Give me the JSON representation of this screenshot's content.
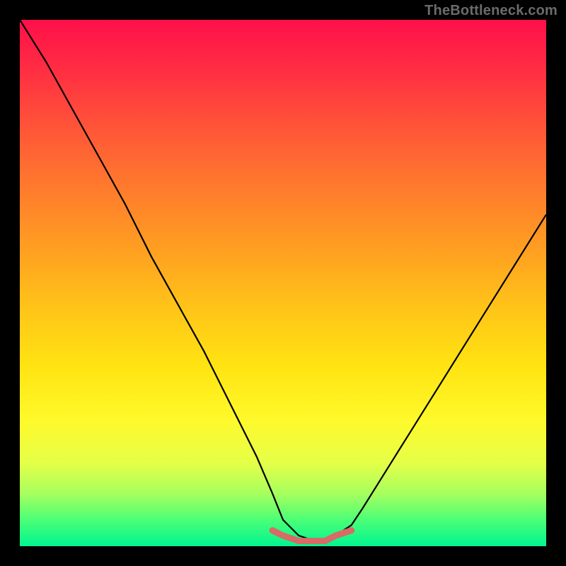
{
  "watermark": "TheBottleneck.com",
  "colors": {
    "frame": "#000000",
    "curve": "#000000",
    "bottom_marker": "#d96a66",
    "gradient_top": "#ff0f4a",
    "gradient_mid": "#ffe412",
    "gradient_bottom": "#00f58f"
  },
  "chart_data": {
    "type": "line",
    "title": "",
    "xlabel": "",
    "ylabel": "",
    "xlim": [
      0,
      100
    ],
    "ylim": [
      0,
      100
    ],
    "grid": false,
    "series": [
      {
        "name": "bottleneck-curve",
        "x": [
          0,
          5,
          10,
          15,
          20,
          25,
          30,
          35,
          40,
          45,
          48,
          50,
          53,
          56,
          58,
          60,
          63,
          65,
          70,
          75,
          80,
          85,
          90,
          95,
          100
        ],
        "values": [
          100,
          92,
          83,
          74,
          65,
          55,
          46,
          37,
          27,
          17,
          10,
          5,
          2,
          1,
          1,
          2,
          4,
          7,
          15,
          23,
          31,
          39,
          47,
          55,
          63
        ]
      },
      {
        "name": "optimal-range-marker",
        "x": [
          48,
          50,
          53,
          56,
          58,
          60,
          63
        ],
        "values": [
          3,
          2,
          1,
          1,
          1,
          2,
          3
        ]
      }
    ],
    "annotations": []
  }
}
